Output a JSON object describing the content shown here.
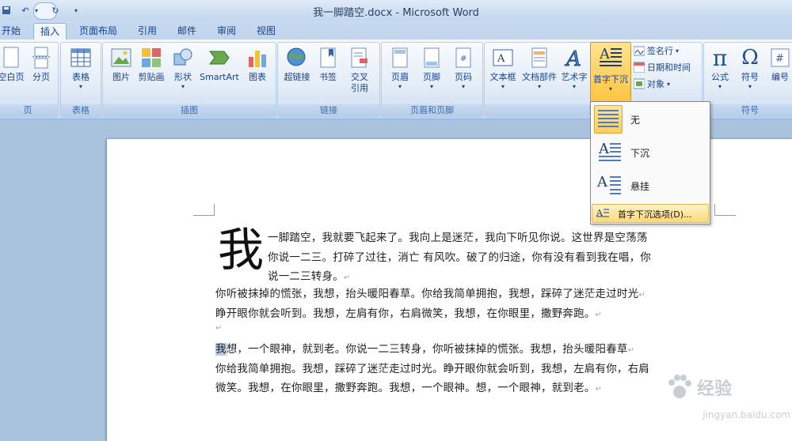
{
  "window": {
    "title": "我一脚踏空.docx - Microsoft Word"
  },
  "tabs": [
    "开始",
    "插入",
    "页面布局",
    "引用",
    "邮件",
    "审阅",
    "视图"
  ],
  "active_tab": "插入",
  "groups": {
    "pages": {
      "label": "页",
      "buttons": [
        "空白页",
        "分页"
      ]
    },
    "table": {
      "label": "表格",
      "buttons": [
        "表格"
      ]
    },
    "illustrations": {
      "label": "插图",
      "buttons": [
        "图片",
        "剪贴画",
        "形状",
        "SmartArt",
        "图表"
      ]
    },
    "links": {
      "label": "链接",
      "buttons": [
        "超链接",
        "书签",
        "交叉\n引用"
      ]
    },
    "header_footer": {
      "label": "页眉和页脚",
      "buttons": [
        "页眉",
        "页脚",
        "页码"
      ]
    },
    "text": {
      "label": "文",
      "buttons": [
        "文本框",
        "文档部件",
        "艺术字",
        "首字下沉"
      ],
      "small": [
        "签名行",
        "日期和时间",
        "对象"
      ]
    },
    "symbols": {
      "label": "符号",
      "buttons": [
        "公式",
        "符号",
        "编号"
      ]
    }
  },
  "dropcap_menu": {
    "items": [
      "无",
      "下沉",
      "悬挂"
    ],
    "options": "首字下沉选项(D)..."
  },
  "document": {
    "dropcap_char": "我",
    "para1_lines": [
      "一脚踏空，我就要飞起来了。我向上是迷茫，我向下听见你说。这世界是空荡荡",
      "你说一二三。打碎了过往，消亡 有风吹。破了的归途，你有没有看到我在唱，你",
      "说一二三转身。"
    ],
    "para2_lines": [
      "你听被抹掉的慌张，我想，抬头暖阳春草。你给我简单拥抱，我想，踩碎了迷茫走过时光",
      "睁开眼你就会听到。我想，左肩有你，右肩微笑，我想，在你眼里，撒野奔跑。"
    ],
    "para3_first_char": "我",
    "para3_lines": [
      "想，一个眼神，就到老。你说一二三转身，你听被抹掉的慌张。我想，抬头暖阳春草",
      "你给我简单拥抱。我想，踩碎了迷茫走过时光。睁开眼你就会听到，我想，左肩有你，右肩",
      "微笑。我想，在你眼里，撒野奔跑。我想，一个眼神。想，一个眼神，就到老。"
    ]
  },
  "watermark": {
    "brand": "经验",
    "url": "jingyan.baidu.com"
  }
}
